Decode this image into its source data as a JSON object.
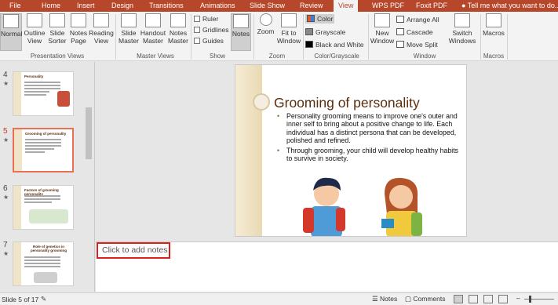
{
  "tabs": [
    "File",
    "Home",
    "Insert",
    "Design",
    "Transitions",
    "Animations",
    "Slide Show",
    "Review",
    "View",
    "WPS PDF",
    "Foxit PDF"
  ],
  "active_tab": "View",
  "tell_me": "Tell me what you want to do...",
  "ribbon": {
    "presentation_views": {
      "label": "Presentation Views",
      "buttons": [
        "Normal",
        "Outline View",
        "Slide Sorter",
        "Notes Page",
        "Reading View"
      ]
    },
    "master_views": {
      "label": "Master Views",
      "buttons": [
        "Slide Master",
        "Handout Master",
        "Notes Master"
      ]
    },
    "show": {
      "label": "Show",
      "checks": [
        "Ruler",
        "Gridlines",
        "Guides"
      ],
      "notes": "Notes"
    },
    "zoom": {
      "label": "Zoom",
      "buttons": [
        "Zoom",
        "Fit to Window"
      ]
    },
    "color": {
      "label": "Color/Grayscale",
      "items": [
        "Color",
        "Grayscale",
        "Black and White"
      ]
    },
    "window": {
      "label": "Window",
      "new_window": "New Window",
      "items": [
        "Arrange All",
        "Cascade",
        "Move Split"
      ],
      "switch": "Switch Windows"
    },
    "macros": {
      "label": "Macros",
      "button": "Macros"
    }
  },
  "thumbnails": [
    {
      "num": "4",
      "title": "Personality"
    },
    {
      "num": "5",
      "title": "Grooming of personality"
    },
    {
      "num": "6",
      "title": "Factors of grooming personality"
    },
    {
      "num": "7",
      "title": "Role of genetics in personality grooming"
    }
  ],
  "slide": {
    "title": "Grooming of personality",
    "bullets": [
      "Personality grooming means to improve one's outer and inner self to bring about a positive change to life. Each individual has a distinct persona that can be developed, polished and refined.",
      " Through grooming, your child will develop healthy habits to survive in society."
    ]
  },
  "notes_placeholder": "Click to add notes",
  "status": {
    "slide": "Slide 5 of 17",
    "notes": "Notes",
    "comments": "Comments"
  },
  "colors": {
    "accent": "#b7472a",
    "title": "#5a2d0c",
    "selection": "#e97055"
  }
}
